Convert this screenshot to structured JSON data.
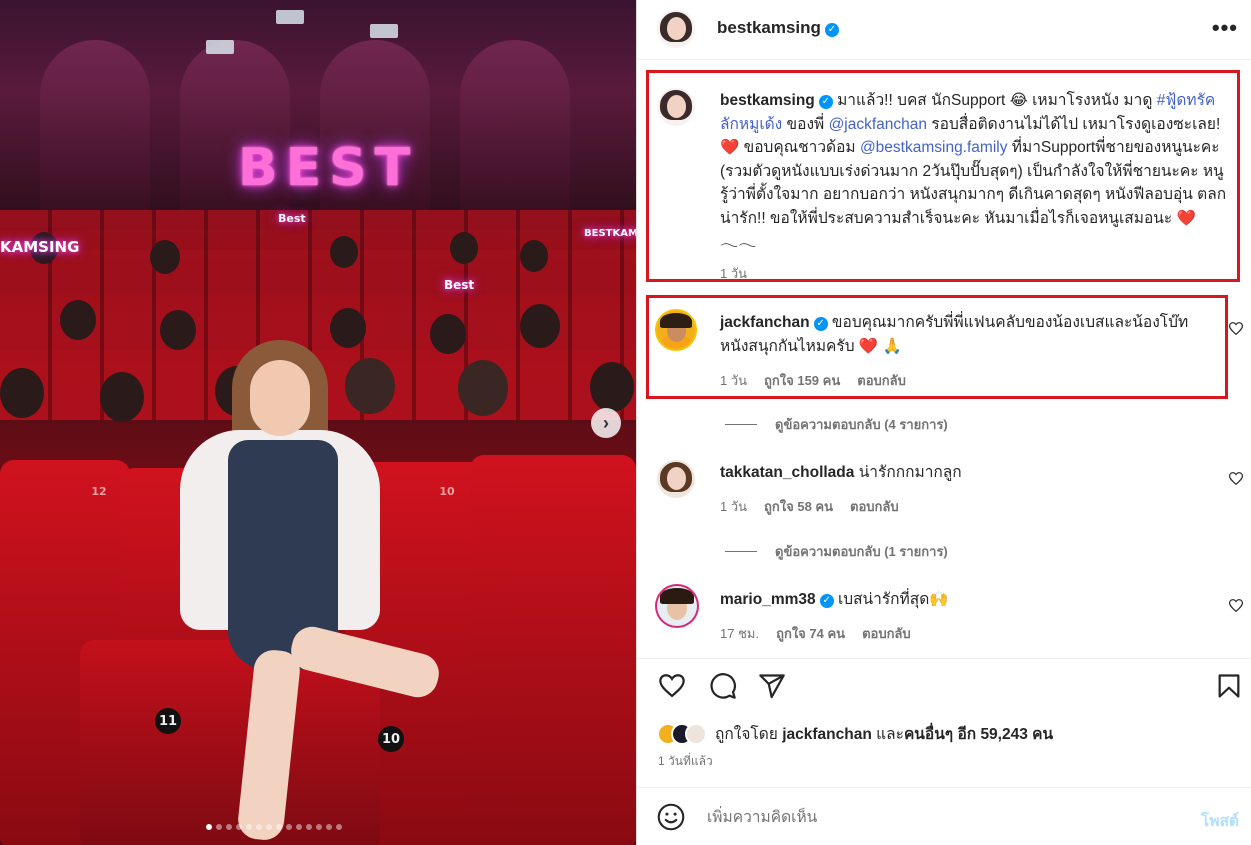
{
  "photo": {
    "neon_sign": "BEST",
    "neon_small_left": "KAMSING",
    "neon_small_1": "Best",
    "neon_small_2": "Best",
    "neon_small_3": "BESTKAM",
    "seat_numbers": [
      "12",
      "10",
      "11",
      "10"
    ],
    "next_icon": "›",
    "carousel_count": 14,
    "carousel_active": 0
  },
  "header": {
    "username": "bestkamsing",
    "verified": true,
    "more_icon": "•••"
  },
  "caption": {
    "username": "bestkamsing",
    "text_1": " มาแล้ว!! บคส นักSupport 😂 เหมาโรงหนัง มาดู ",
    "hashtag": "#ฟู้ดทรัคลักหมูเด้ง",
    "text_2": " ของพี่ ",
    "mention_1": "@jackfanchan",
    "text_3": " รอบสื่อติดงานไม่ได้ไป เหมาโรงดูเองซะเลย! ",
    "heart_1": "❤️",
    "text_4": " ขอบคุณชาวด้อม ",
    "mention_2": "@bestkamsing.family",
    "text_5": " ที่มาSupportพี่ชายของหนูนะคะ (รวมตัวดูหนังแบบเร่งด่วนมาก 2วันปุ๊บปั๊บสุดๆ) เป็นกำลังใจให้พี่ชายนะคะ หนูรู้ว่าพี่ตั้งใจมาก อยากบอกว่า หนังสนุกมากๆ ดีเกินคาดสุดๆ หนังฟีลอบอุ่น ตลก น่ารัก!! ขอให้พี่ประสบความสำเร็จนะคะ หันมาเมื่อไรก็เจอหนูเสมอนะ ",
    "heart_2": "❤️",
    "tail": "𓂃𓂃",
    "time": "1 วัน"
  },
  "comments": [
    {
      "username": "jackfanchan",
      "verified": true,
      "text": " ขอบคุณมากครับพี่พี่แฟนคลับของน้องเบสและน้องโบ๊ท หนังสนุกกันไหมครับ ",
      "emojis": "❤️ 🙏",
      "time": "1 วัน",
      "likes": "ถูกใจ 159 คน",
      "reply": "ตอบกลับ",
      "view_replies": "ดูข้อความตอบกลับ (4 รายการ)"
    },
    {
      "username": "takkatan_chollada",
      "verified": false,
      "text": " น่ารักกกมากลูก",
      "emojis": "",
      "time": "1 วัน",
      "likes": "ถูกใจ 58 คน",
      "reply": "ตอบกลับ",
      "view_replies": "ดูข้อความตอบกลับ (1 รายการ)"
    },
    {
      "username": "mario_mm38",
      "verified": true,
      "text": " เบสน่ารักที่สุด",
      "emojis": "🙌",
      "time": "17 ชม.",
      "likes": "ถูกใจ 74 คน",
      "reply": "ตอบกลับ",
      "view_replies": ""
    }
  ],
  "actions": {
    "like_icon": "heart-outline",
    "comment_icon": "comment-bubble",
    "share_icon": "paper-plane",
    "save_icon": "bookmark"
  },
  "likes": {
    "prefix": "ถูกใจโดย ",
    "first_user": "jackfanchan",
    "middle": " และ",
    "others": "คนอื่นๆ อีก 59,243 คน",
    "time_ago": "1 วันที่แล้ว"
  },
  "composer": {
    "placeholder": "เพิ่มความคิดเห็น",
    "post_label": "โพสต์",
    "emoji_icon": "smiley"
  },
  "colors": {
    "link": "#4463c7",
    "verified": "#0095f6",
    "highlight_box": "#d9161d",
    "post_disabled": "#b2dffc"
  }
}
